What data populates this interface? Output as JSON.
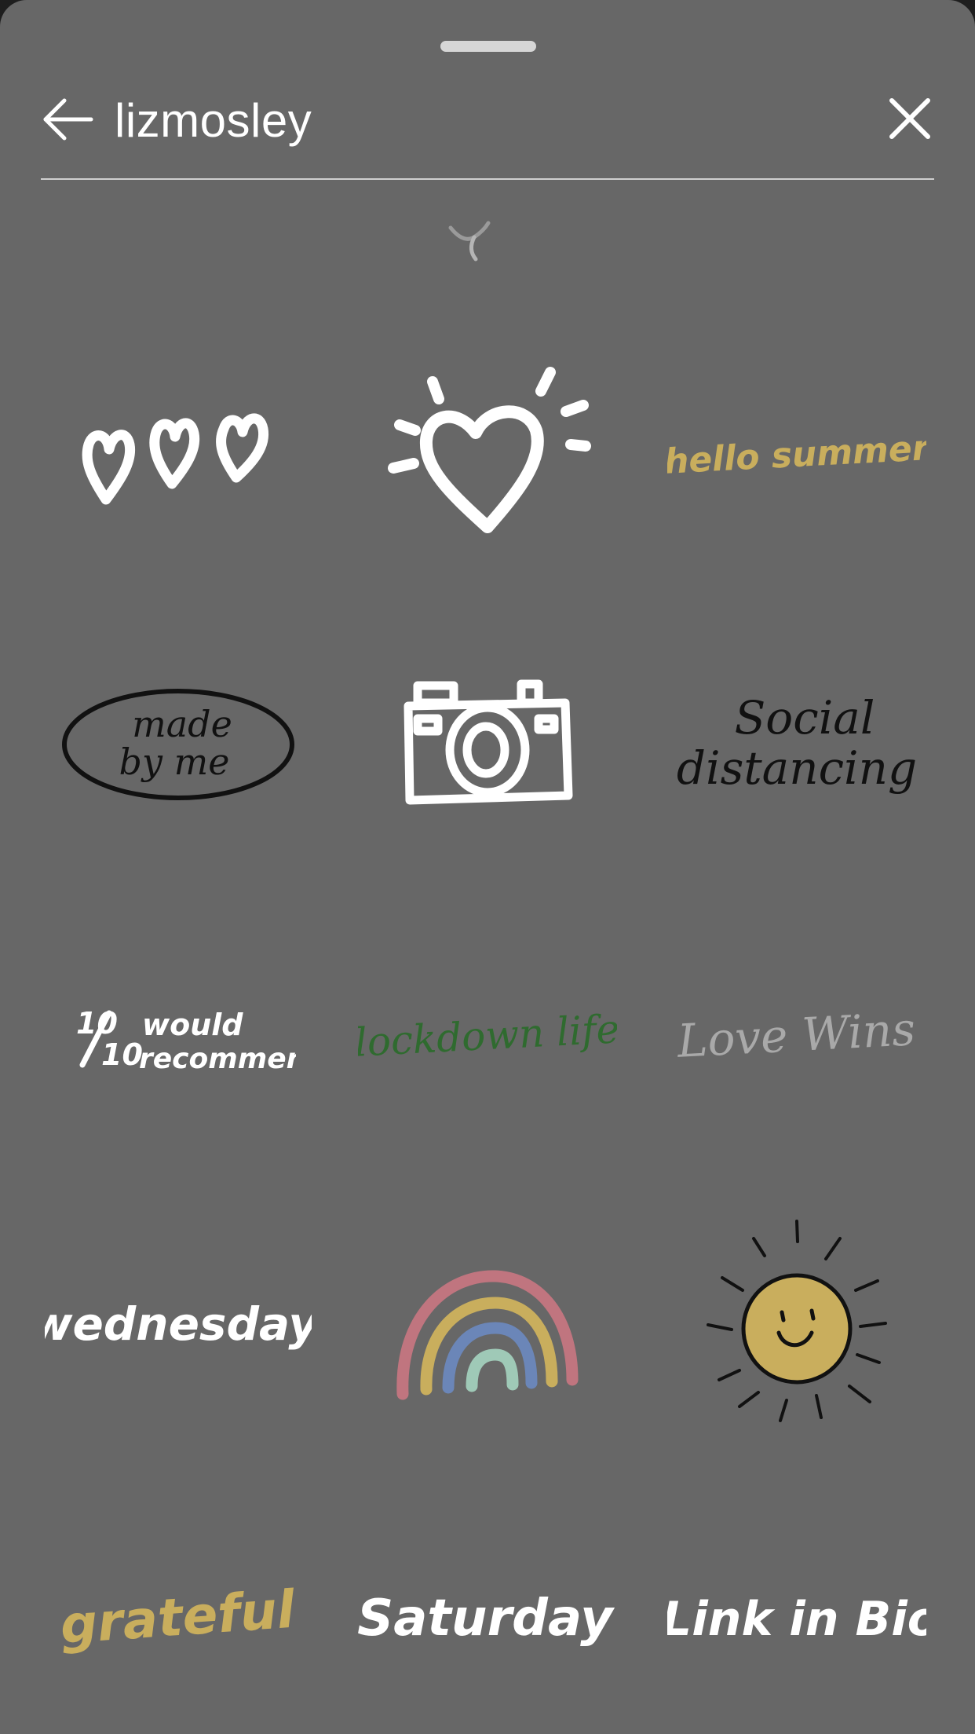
{
  "search": {
    "query": "lizmosley"
  },
  "colors": {
    "sheet_bg": "#676767",
    "text": "#ffffff",
    "gold": "#c9ae5d",
    "green": "#2f6b2f",
    "light_gray": "#a9a9a9",
    "black": "#111111"
  },
  "stickers": [
    {
      "icon": "three-hearts",
      "text": ""
    },
    {
      "icon": "heart-burst",
      "text": ""
    },
    {
      "icon": "text",
      "text": "hello summer"
    },
    {
      "icon": "badge",
      "line1": "made",
      "line2": "by me"
    },
    {
      "icon": "camera",
      "text": ""
    },
    {
      "icon": "text",
      "line1": "Social",
      "line2": "distancing"
    },
    {
      "icon": "rating",
      "num": "10",
      "den": "10",
      "line1": "would",
      "line2": "recommend"
    },
    {
      "icon": "text",
      "text": "lockdown life"
    },
    {
      "icon": "text",
      "text": "Love Wins"
    },
    {
      "icon": "text",
      "text": "wednesday"
    },
    {
      "icon": "rainbow",
      "text": ""
    },
    {
      "icon": "sun",
      "text": ""
    },
    {
      "icon": "text",
      "text": "grateful"
    },
    {
      "icon": "text",
      "text": "Saturday"
    },
    {
      "icon": "text",
      "text": "Link in Bio"
    }
  ]
}
